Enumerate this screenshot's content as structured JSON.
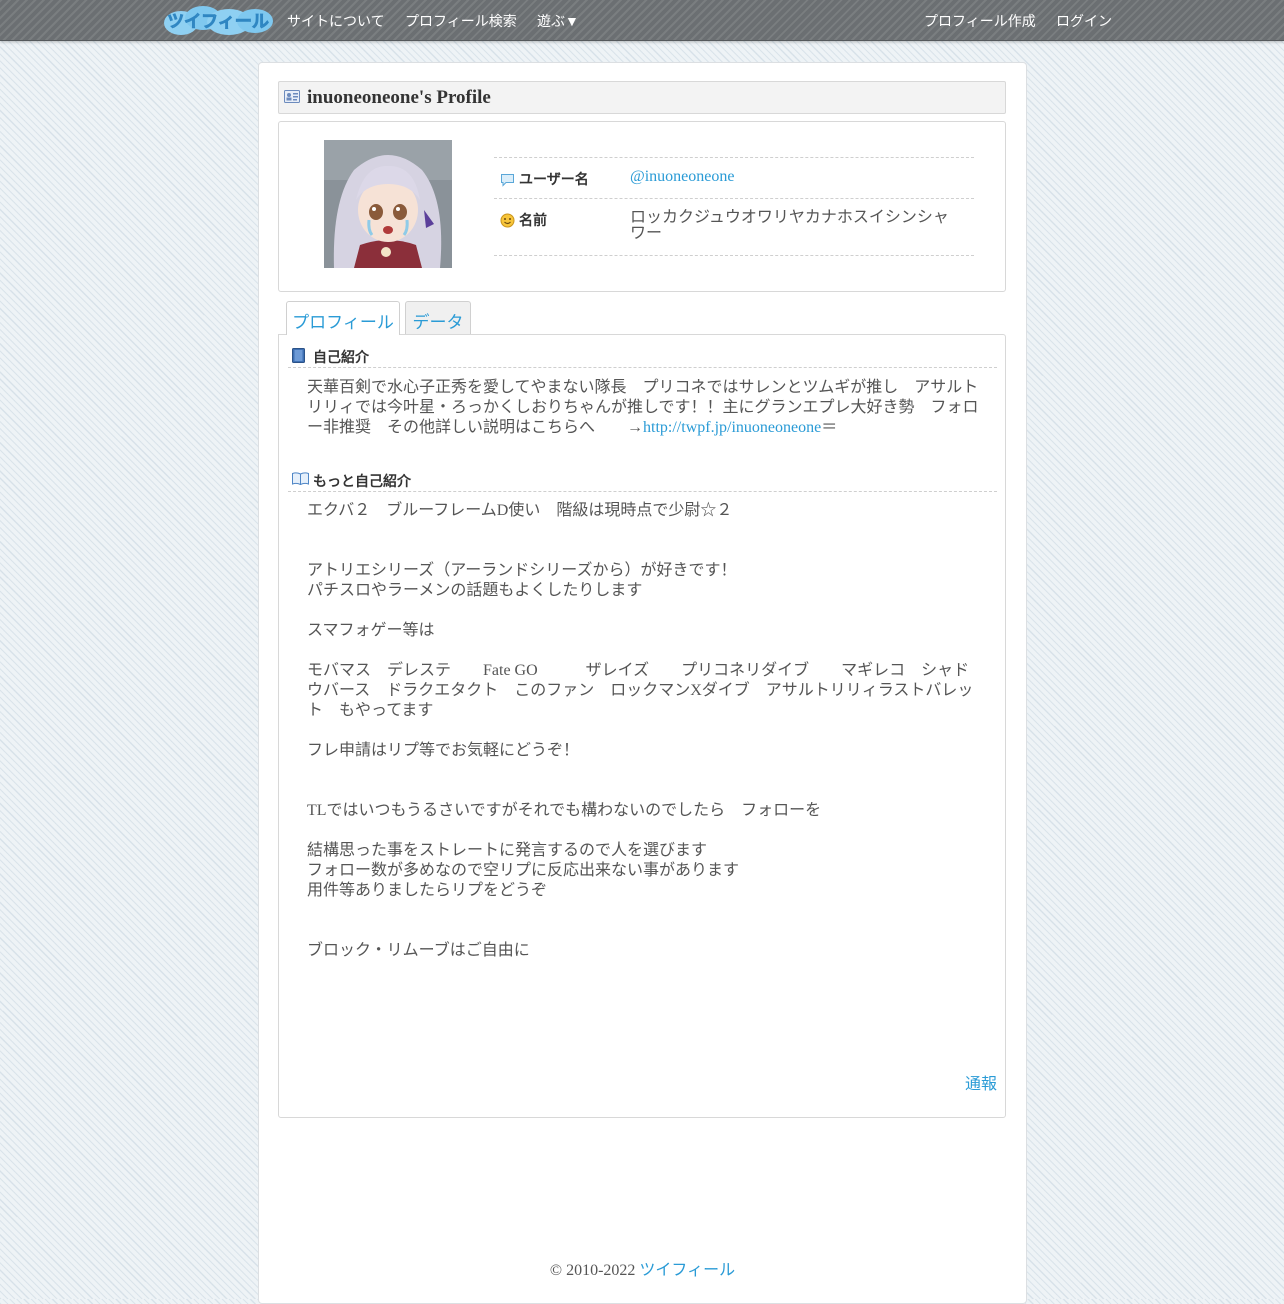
{
  "nav": {
    "logo_text": "ツイフィール",
    "links_left": [
      "サイトについて",
      "プロフィール検索",
      "遊ぶ▼"
    ],
    "links_right": [
      "プロフィール作成",
      "ログイン"
    ]
  },
  "profile": {
    "title": "inuoneoneone's Profile",
    "username_label": "ユーザー名",
    "username": "@inuoneoneone",
    "name_label": "名前",
    "name": "ロッカクジュウオワリヤカナホスイシンシャワー"
  },
  "tabs": [
    "プロフィール",
    "データ"
  ],
  "self_intro": {
    "heading": "自己紹介",
    "text": "天華百剣で水心子正秀を愛してやまない隊長　プリコネではサレンとツムギが推し　アサルトリリィでは今叶星・ろっかくしおりちゃんが推しです！！主にグランエプレ大好き勢　フォロー非推奨　その他詳しい説明はこちらへ　　→",
    "link": "http://twpf.jp/inuoneoneone",
    "suffix": "＝"
  },
  "more_intro": {
    "heading": "もっと自己紹介",
    "lines": [
      "エクバ２　ブルーフレームD使い　階級は現時点で少尉☆２",
      "",
      "",
      "アトリエシリーズ（アーランドシリーズから）が好きです！",
      "パチスロやラーメンの話題もよくしたりします",
      "",
      "スマフォゲー等は",
      "",
      "モバマス　デレステ　　Fate GO　　　ザレイズ　　プリコネリダイブ　　マギレコ　シャドウバース　ドラクエタクト　このファン　ロックマンXダイブ　アサルトリリィラストバレット　もやってます",
      "",
      "フレ申請はリプ等でお気軽にどうぞ！",
      "",
      "",
      "TLではいつもうるさいですがそれでも構わないのでしたら　フォローを",
      "",
      "結構思った事をストレートに発言するので人を選びます",
      "フォロー数が多めなので空リプに反応出来ない事があります",
      "用件等ありましたらリプをどうぞ",
      "",
      "",
      "ブロック・リムーブはご自由に"
    ]
  },
  "report_label": "通報",
  "footer": {
    "copyright": "© 2010-2022",
    "site_link": "ツイフィール"
  }
}
